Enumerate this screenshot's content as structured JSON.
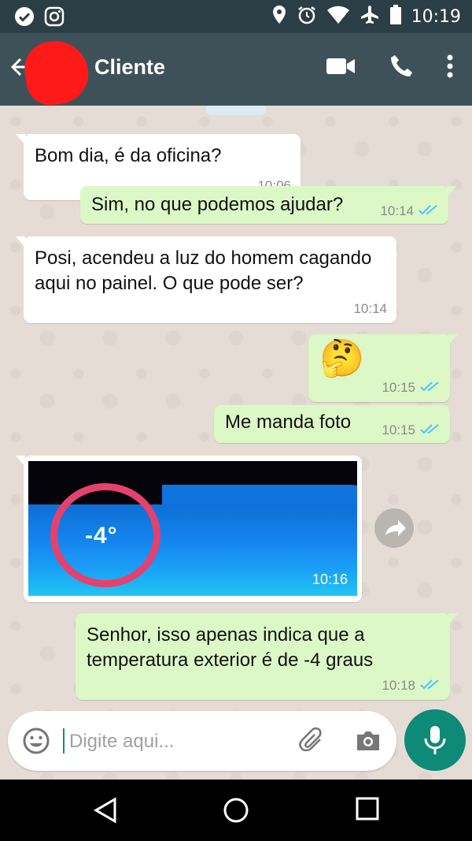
{
  "status_bar": {
    "time": "10:19",
    "left_icons": [
      "check-circle-icon",
      "instagram-icon"
    ],
    "right_icons": [
      "location-icon",
      "alarm-icon",
      "wifi-icon",
      "airplane-icon",
      "battery-icon"
    ]
  },
  "header": {
    "title": "Cliente",
    "icons": [
      "back-arrow-icon",
      "video-call-icon",
      "phone-icon",
      "more-vert-icon"
    ]
  },
  "messages": [
    {
      "direction": "in",
      "text": "Bom dia, é da oficina?",
      "time": "10:06"
    },
    {
      "direction": "out",
      "text": "Sim, no que podemos ajudar?",
      "time": "10:14",
      "status": "read"
    },
    {
      "direction": "in",
      "text": "Posi, acendeu a luz do homem cagando aqui no painel. O que pode ser?",
      "time": "10:14"
    },
    {
      "direction": "out",
      "text": "🤔",
      "time": "10:15",
      "status": "read"
    },
    {
      "direction": "out",
      "text": "Me manda foto",
      "time": "10:15",
      "status": "read"
    },
    {
      "direction": "in",
      "type": "image",
      "image_text": "-4°",
      "time": "10:16"
    },
    {
      "direction": "out",
      "text": "Senhor, isso apenas indica que a temperatura exterior é de -4 graus",
      "time": "10:18",
      "status": "read"
    }
  ],
  "composer": {
    "placeholder": "Digite aqui...",
    "icons": [
      "emoji-icon",
      "attach-icon",
      "camera-icon",
      "mic-icon"
    ]
  },
  "colors": {
    "header": "#3e5158",
    "status_bar": "#2b3e45",
    "chat_bg": "#e5ddd5",
    "outgoing_bubble": "#dcf8c6",
    "incoming_bubble": "#ffffff",
    "read_ticks": "#4fc3f7",
    "mic_button": "#0d8a78",
    "avatar_scribble": "#ff1a1a"
  },
  "nav_bar": {
    "icons": [
      "back-triangle-icon",
      "home-circle-icon",
      "recents-square-icon"
    ]
  }
}
